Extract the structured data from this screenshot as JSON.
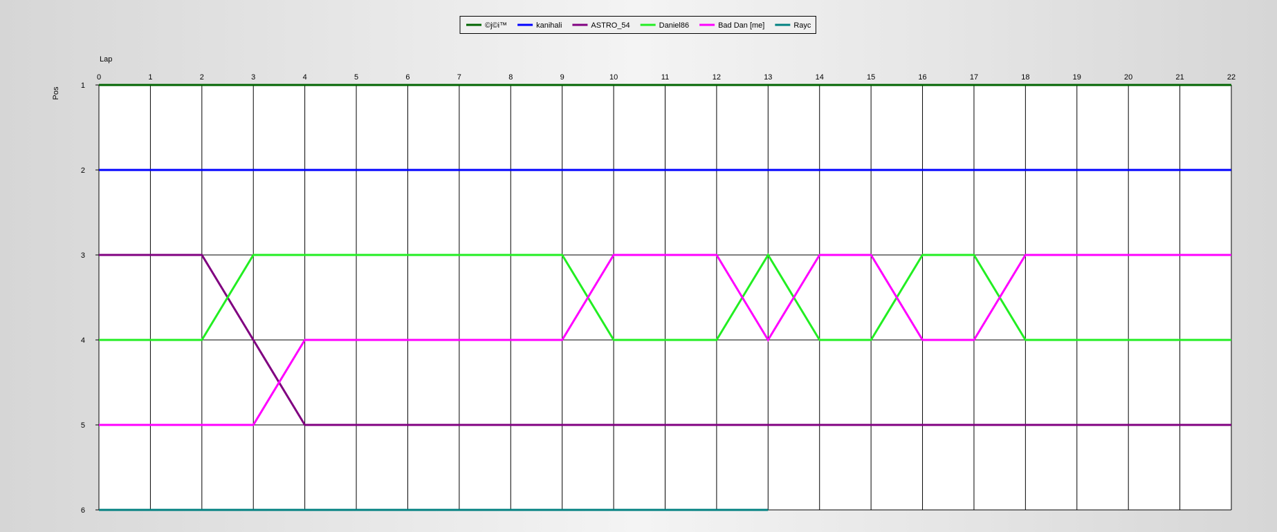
{
  "chart_data": {
    "type": "line",
    "title": "",
    "xlabel": "Lap",
    "ylabel": "Pos",
    "x": [
      0,
      1,
      2,
      3,
      4,
      5,
      6,
      7,
      8,
      9,
      10,
      11,
      12,
      13,
      14,
      15,
      16,
      17,
      18,
      19,
      20,
      21,
      22
    ],
    "xlim": [
      0,
      22
    ],
    "ylim": [
      1,
      6
    ],
    "y_inverted": true,
    "x_ticks": [
      0,
      1,
      2,
      3,
      4,
      5,
      6,
      7,
      8,
      9,
      10,
      11,
      12,
      13,
      14,
      15,
      16,
      17,
      18,
      19,
      20,
      21,
      22
    ],
    "y_ticks": [
      1,
      2,
      3,
      4,
      5,
      6
    ],
    "grid": true,
    "legend_position": "top-center",
    "series": [
      {
        "name": "©j©i™",
        "color": "#006400",
        "values": [
          1,
          1,
          1,
          1,
          1,
          1,
          1,
          1,
          1,
          1,
          1,
          1,
          1,
          1,
          1,
          1,
          1,
          1,
          1,
          1,
          1,
          1,
          1
        ]
      },
      {
        "name": "kanihali",
        "color": "#0000ff",
        "values": [
          2,
          2,
          2,
          2,
          2,
          2,
          2,
          2,
          2,
          2,
          2,
          2,
          2,
          2,
          2,
          2,
          2,
          2,
          2,
          2,
          2,
          2,
          2
        ]
      },
      {
        "name": "ASTRO_54",
        "color": "#800080",
        "values": [
          3,
          3,
          3,
          4,
          5,
          5,
          5,
          5,
          5,
          5,
          5,
          5,
          5,
          5,
          5,
          5,
          5,
          5,
          5,
          5,
          5,
          5,
          5
        ]
      },
      {
        "name": "Daniel86",
        "color": "#22ee22",
        "values": [
          4,
          4,
          4,
          3,
          3,
          3,
          3,
          3,
          3,
          3,
          4,
          4,
          4,
          3,
          4,
          4,
          3,
          3,
          4,
          4,
          4,
          4,
          4
        ]
      },
      {
        "name": "Bad Dan [me]",
        "color": "#ff00ff",
        "values": [
          5,
          5,
          5,
          5,
          4,
          4,
          4,
          4,
          4,
          4,
          3,
          3,
          3,
          4,
          3,
          3,
          4,
          4,
          3,
          3,
          3,
          3,
          3
        ]
      },
      {
        "name": "Rayc",
        "color": "#008080",
        "values": [
          6,
          6,
          6,
          6,
          6,
          6,
          6,
          6,
          6,
          6,
          6,
          6,
          6,
          6
        ]
      }
    ]
  }
}
